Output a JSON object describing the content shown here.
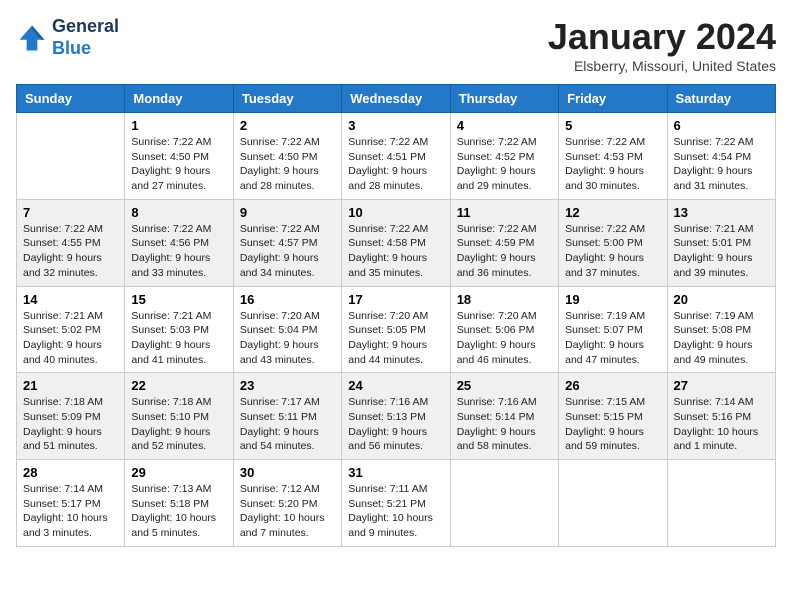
{
  "header": {
    "logo_line1": "General",
    "logo_line2": "Blue",
    "title": "January 2024",
    "subtitle": "Elsberry, Missouri, United States"
  },
  "weekdays": [
    "Sunday",
    "Monday",
    "Tuesday",
    "Wednesday",
    "Thursday",
    "Friday",
    "Saturday"
  ],
  "weeks": [
    [
      {
        "day": "",
        "info": ""
      },
      {
        "day": "1",
        "info": "Sunrise: 7:22 AM\nSunset: 4:50 PM\nDaylight: 9 hours\nand 27 minutes."
      },
      {
        "day": "2",
        "info": "Sunrise: 7:22 AM\nSunset: 4:50 PM\nDaylight: 9 hours\nand 28 minutes."
      },
      {
        "day": "3",
        "info": "Sunrise: 7:22 AM\nSunset: 4:51 PM\nDaylight: 9 hours\nand 28 minutes."
      },
      {
        "day": "4",
        "info": "Sunrise: 7:22 AM\nSunset: 4:52 PM\nDaylight: 9 hours\nand 29 minutes."
      },
      {
        "day": "5",
        "info": "Sunrise: 7:22 AM\nSunset: 4:53 PM\nDaylight: 9 hours\nand 30 minutes."
      },
      {
        "day": "6",
        "info": "Sunrise: 7:22 AM\nSunset: 4:54 PM\nDaylight: 9 hours\nand 31 minutes."
      }
    ],
    [
      {
        "day": "7",
        "info": "Sunrise: 7:22 AM\nSunset: 4:55 PM\nDaylight: 9 hours\nand 32 minutes."
      },
      {
        "day": "8",
        "info": "Sunrise: 7:22 AM\nSunset: 4:56 PM\nDaylight: 9 hours\nand 33 minutes."
      },
      {
        "day": "9",
        "info": "Sunrise: 7:22 AM\nSunset: 4:57 PM\nDaylight: 9 hours\nand 34 minutes."
      },
      {
        "day": "10",
        "info": "Sunrise: 7:22 AM\nSunset: 4:58 PM\nDaylight: 9 hours\nand 35 minutes."
      },
      {
        "day": "11",
        "info": "Sunrise: 7:22 AM\nSunset: 4:59 PM\nDaylight: 9 hours\nand 36 minutes."
      },
      {
        "day": "12",
        "info": "Sunrise: 7:22 AM\nSunset: 5:00 PM\nDaylight: 9 hours\nand 37 minutes."
      },
      {
        "day": "13",
        "info": "Sunrise: 7:21 AM\nSunset: 5:01 PM\nDaylight: 9 hours\nand 39 minutes."
      }
    ],
    [
      {
        "day": "14",
        "info": "Sunrise: 7:21 AM\nSunset: 5:02 PM\nDaylight: 9 hours\nand 40 minutes."
      },
      {
        "day": "15",
        "info": "Sunrise: 7:21 AM\nSunset: 5:03 PM\nDaylight: 9 hours\nand 41 minutes."
      },
      {
        "day": "16",
        "info": "Sunrise: 7:20 AM\nSunset: 5:04 PM\nDaylight: 9 hours\nand 43 minutes."
      },
      {
        "day": "17",
        "info": "Sunrise: 7:20 AM\nSunset: 5:05 PM\nDaylight: 9 hours\nand 44 minutes."
      },
      {
        "day": "18",
        "info": "Sunrise: 7:20 AM\nSunset: 5:06 PM\nDaylight: 9 hours\nand 46 minutes."
      },
      {
        "day": "19",
        "info": "Sunrise: 7:19 AM\nSunset: 5:07 PM\nDaylight: 9 hours\nand 47 minutes."
      },
      {
        "day": "20",
        "info": "Sunrise: 7:19 AM\nSunset: 5:08 PM\nDaylight: 9 hours\nand 49 minutes."
      }
    ],
    [
      {
        "day": "21",
        "info": "Sunrise: 7:18 AM\nSunset: 5:09 PM\nDaylight: 9 hours\nand 51 minutes."
      },
      {
        "day": "22",
        "info": "Sunrise: 7:18 AM\nSunset: 5:10 PM\nDaylight: 9 hours\nand 52 minutes."
      },
      {
        "day": "23",
        "info": "Sunrise: 7:17 AM\nSunset: 5:11 PM\nDaylight: 9 hours\nand 54 minutes."
      },
      {
        "day": "24",
        "info": "Sunrise: 7:16 AM\nSunset: 5:13 PM\nDaylight: 9 hours\nand 56 minutes."
      },
      {
        "day": "25",
        "info": "Sunrise: 7:16 AM\nSunset: 5:14 PM\nDaylight: 9 hours\nand 58 minutes."
      },
      {
        "day": "26",
        "info": "Sunrise: 7:15 AM\nSunset: 5:15 PM\nDaylight: 9 hours\nand 59 minutes."
      },
      {
        "day": "27",
        "info": "Sunrise: 7:14 AM\nSunset: 5:16 PM\nDaylight: 10 hours\nand 1 minute."
      }
    ],
    [
      {
        "day": "28",
        "info": "Sunrise: 7:14 AM\nSunset: 5:17 PM\nDaylight: 10 hours\nand 3 minutes."
      },
      {
        "day": "29",
        "info": "Sunrise: 7:13 AM\nSunset: 5:18 PM\nDaylight: 10 hours\nand 5 minutes."
      },
      {
        "day": "30",
        "info": "Sunrise: 7:12 AM\nSunset: 5:20 PM\nDaylight: 10 hours\nand 7 minutes."
      },
      {
        "day": "31",
        "info": "Sunrise: 7:11 AM\nSunset: 5:21 PM\nDaylight: 10 hours\nand 9 minutes."
      },
      {
        "day": "",
        "info": ""
      },
      {
        "day": "",
        "info": ""
      },
      {
        "day": "",
        "info": ""
      }
    ]
  ]
}
